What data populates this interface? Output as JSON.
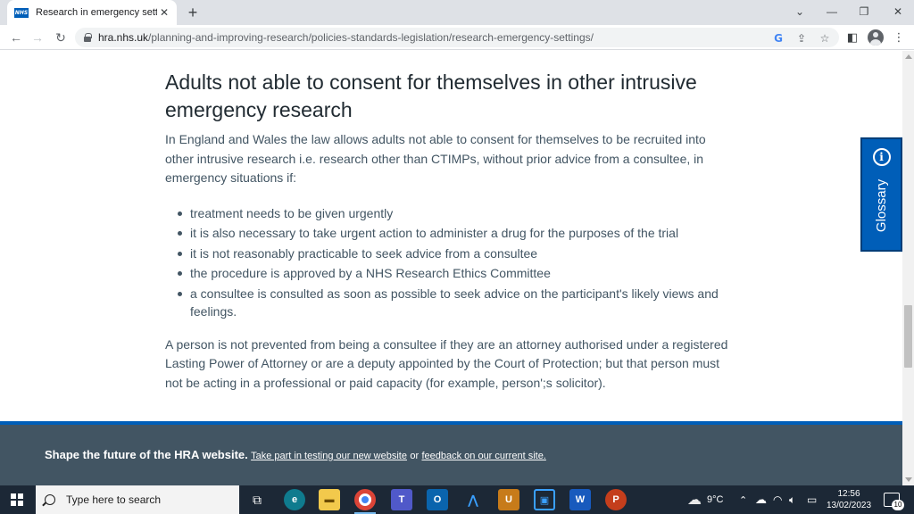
{
  "browser": {
    "tab_title": "Research in emergency settings",
    "tab_favicon": "NHS",
    "url_domain": "hra.nhs.uk",
    "url_path": "/planning-and-improving-research/policies-standards-legislation/research-emergency-settings/"
  },
  "article": {
    "heading": "Adults not able to consent for themselves in other intrusive emergency research",
    "intro": "In England and Wales the law allows adults not able to consent for themselves to be recruited into other intrusive research i.e. research other than CTIMPs, without prior advice from a consultee, in emergency situations if:",
    "bullets": [
      "treatment needs to be given urgently",
      "it is also necessary to take urgent action to administer a drug for the purposes of the trial",
      "it is not reasonably practicable to seek advice from a consultee",
      "the procedure is approved by a NHS Research Ethics Committee",
      "a consultee is consulted as soon as possible to seek advice on the participant's likely views and feelings."
    ],
    "closing": "A person is not prevented from being a consultee if they are an attorney authorised under a registered Lasting Power of Attorney or are a deputy appointed by the Court of Protection; but that person must not be acting in a professional or paid capacity (for example, person';s solicitor)."
  },
  "glossary": {
    "label": "Glossary",
    "icon": "i"
  },
  "footer": {
    "lead": "Shape the future of the HRA website.",
    "link1": "Take part in testing our new website",
    "connector": "or",
    "link2": "feedback on our current site."
  },
  "taskbar": {
    "search_placeholder": "Type here to search",
    "weather": "9°C",
    "time": "12:56",
    "date": "13/02/2023",
    "notifications": "10"
  },
  "colors": {
    "nhs_blue": "#005eb8",
    "footer_bg": "#425563",
    "body_text": "#425563",
    "heading_text": "#212b32"
  }
}
